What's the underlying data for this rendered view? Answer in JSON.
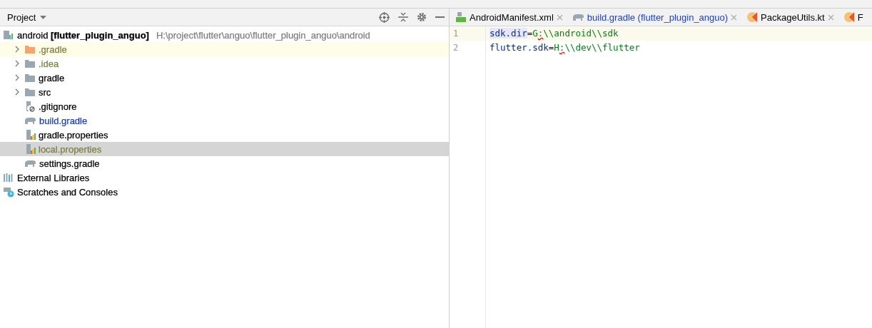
{
  "project_panel": {
    "title": "Project",
    "tree": [
      {
        "label": "android **[flutter_plugin_anguo]**",
        "path": "H:\\project\\flutter\\anguo\\flutter_plugin_anguo\\android",
        "kind": "module",
        "color": "#000000",
        "selected": false,
        "children": [
          {
            "label": ".gradle",
            "kind": "folder-excluded",
            "color": "#7f7f3f",
            "selected": false,
            "expanded": false
          },
          {
            "label": ".idea",
            "kind": "folder",
            "color": "#7f7f3f",
            "selected": false,
            "expanded": false
          },
          {
            "label": "gradle",
            "kind": "folder",
            "color": "#000000",
            "selected": false,
            "expanded": false
          },
          {
            "label": "src",
            "kind": "folder",
            "color": "#000000",
            "selected": false,
            "expanded": false
          },
          {
            "label": ".gitignore",
            "kind": "ignore-file",
            "color": "#000000",
            "selected": false
          },
          {
            "label": "build.gradle",
            "kind": "gradle",
            "color": "#1f3fbf",
            "selected": false
          },
          {
            "label": "gradle.properties",
            "kind": "properties",
            "color": "#000000",
            "selected": false
          },
          {
            "label": "local.properties",
            "kind": "properties",
            "color": "#7f7f3f",
            "selected": true
          },
          {
            "label": "settings.gradle",
            "kind": "gradle",
            "color": "#000000",
            "selected": false
          }
        ]
      },
      {
        "label": "External Libraries",
        "kind": "libraries",
        "color": "#000000",
        "selected": false
      },
      {
        "label": "Scratches and Consoles",
        "kind": "scratches",
        "color": "#000000",
        "selected": false
      }
    ]
  },
  "editor": {
    "tabs": [
      {
        "label": "AndroidManifest.xml",
        "kind": "manifest",
        "color": "#000000",
        "selected": false
      },
      {
        "label": "build.gradle (flutter_plugin_anguo)",
        "kind": "gradle",
        "color": "#1f3fbf",
        "selected": false
      },
      {
        "label": "PackageUtils.kt",
        "kind": "kotlin",
        "color": "#000000",
        "selected": false
      },
      {
        "label": "F",
        "kind": "kotlin",
        "color": "#000000",
        "selected": false
      }
    ],
    "lines": [
      {
        "number": "1",
        "current": true,
        "segments": [
          {
            "text": "sdk.dir",
            "kind": "key-highlight"
          },
          {
            "text": "=",
            "kind": "op"
          },
          {
            "text": "G",
            "kind": "value"
          },
          {
            "text": ":",
            "kind": "value-error"
          },
          {
            "text": "\\\\android\\\\sdk",
            "kind": "value"
          }
        ]
      },
      {
        "number": "2",
        "current": false,
        "segments": [
          {
            "text": "flutter.sdk",
            "kind": "key"
          },
          {
            "text": "=",
            "kind": "op"
          },
          {
            "text": "H",
            "kind": "value"
          },
          {
            "text": ":",
            "kind": "value-error"
          },
          {
            "text": "\\\\dev\\\\flutter",
            "kind": "value"
          }
        ]
      }
    ]
  }
}
